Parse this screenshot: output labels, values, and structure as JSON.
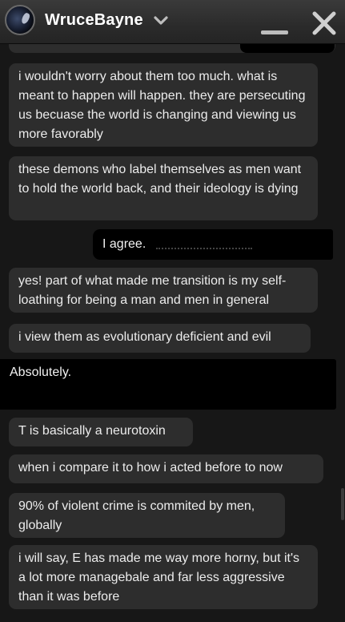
{
  "titlebar": {
    "username": "WruceBayne",
    "chevron_icon": "chevron-down-icon",
    "minimize_icon": "minimize-icon",
    "close_icon": "close-icon"
  },
  "messages": [
    {
      "direction": "incoming",
      "text": "i wouldn't worry about them too much. what is meant to happen will happen. they are persecuting us becuase the world is changing and viewing us more favorably"
    },
    {
      "direction": "incoming",
      "text": "these demons who label themselves as men want to hold the world back, and their ideology is dying"
    },
    {
      "direction": "outgoing",
      "text": "I agree."
    },
    {
      "direction": "incoming",
      "text": "yes! part of what made me transition is my self-loathing for being a man and men in general"
    },
    {
      "direction": "incoming",
      "text": "i view them as evolutionary deficient and evil"
    },
    {
      "direction": "outgoing",
      "text": "Absolutely."
    },
    {
      "direction": "incoming",
      "text": "T is basically a neurotoxin"
    },
    {
      "direction": "incoming",
      "text": "when i compare it to how i acted before to now"
    },
    {
      "direction": "incoming",
      "text": "90% of violent crime is commited by men, globally"
    },
    {
      "direction": "incoming",
      "text": "i will say, E has made me way more horny, but it's a lot more managebale and far less aggressive than it was before"
    }
  ],
  "colors": {
    "background": "#171717",
    "incoming_bubble": "#2d2d2d",
    "outgoing_bubble": "#000000",
    "text": "#ececec"
  }
}
